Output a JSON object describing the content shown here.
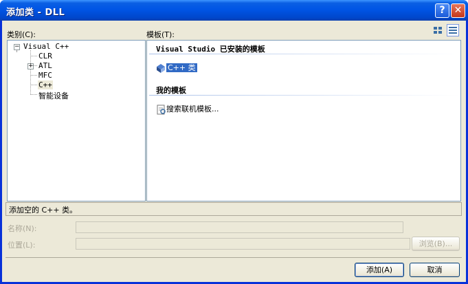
{
  "window": {
    "title": "添加类 - DLL",
    "help_glyph": "?",
    "close_glyph": "✕"
  },
  "categories": {
    "label": "类别(C):",
    "items": [
      {
        "label": "Visual C++",
        "expander": "−"
      },
      {
        "label": "CLR"
      },
      {
        "label": "ATL",
        "expander": "+"
      },
      {
        "label": "MFC"
      },
      {
        "label": "C++"
      },
      {
        "label": "智能设备"
      }
    ]
  },
  "templates": {
    "label": "模板(T):",
    "installed_header": "Visual Studio 已安装的模板",
    "installed_items": [
      {
        "label": "C++ 类"
      }
    ],
    "my_header": "我的模板",
    "my_items": [
      {
        "label": "搜索联机模板..."
      }
    ]
  },
  "status": {
    "text": "添加空的 C++ 类。"
  },
  "form": {
    "name_label": "名称(N):",
    "name_value": "",
    "location_label": "位置(L):",
    "location_value": "",
    "browse_label": "浏览(B)..."
  },
  "buttons": {
    "add_label": "添加(A)",
    "cancel_label": "取消"
  },
  "colors": {
    "title_bar": "#0055e5",
    "dialog_bg": "#ece9d8",
    "selection": "#316ac5"
  }
}
